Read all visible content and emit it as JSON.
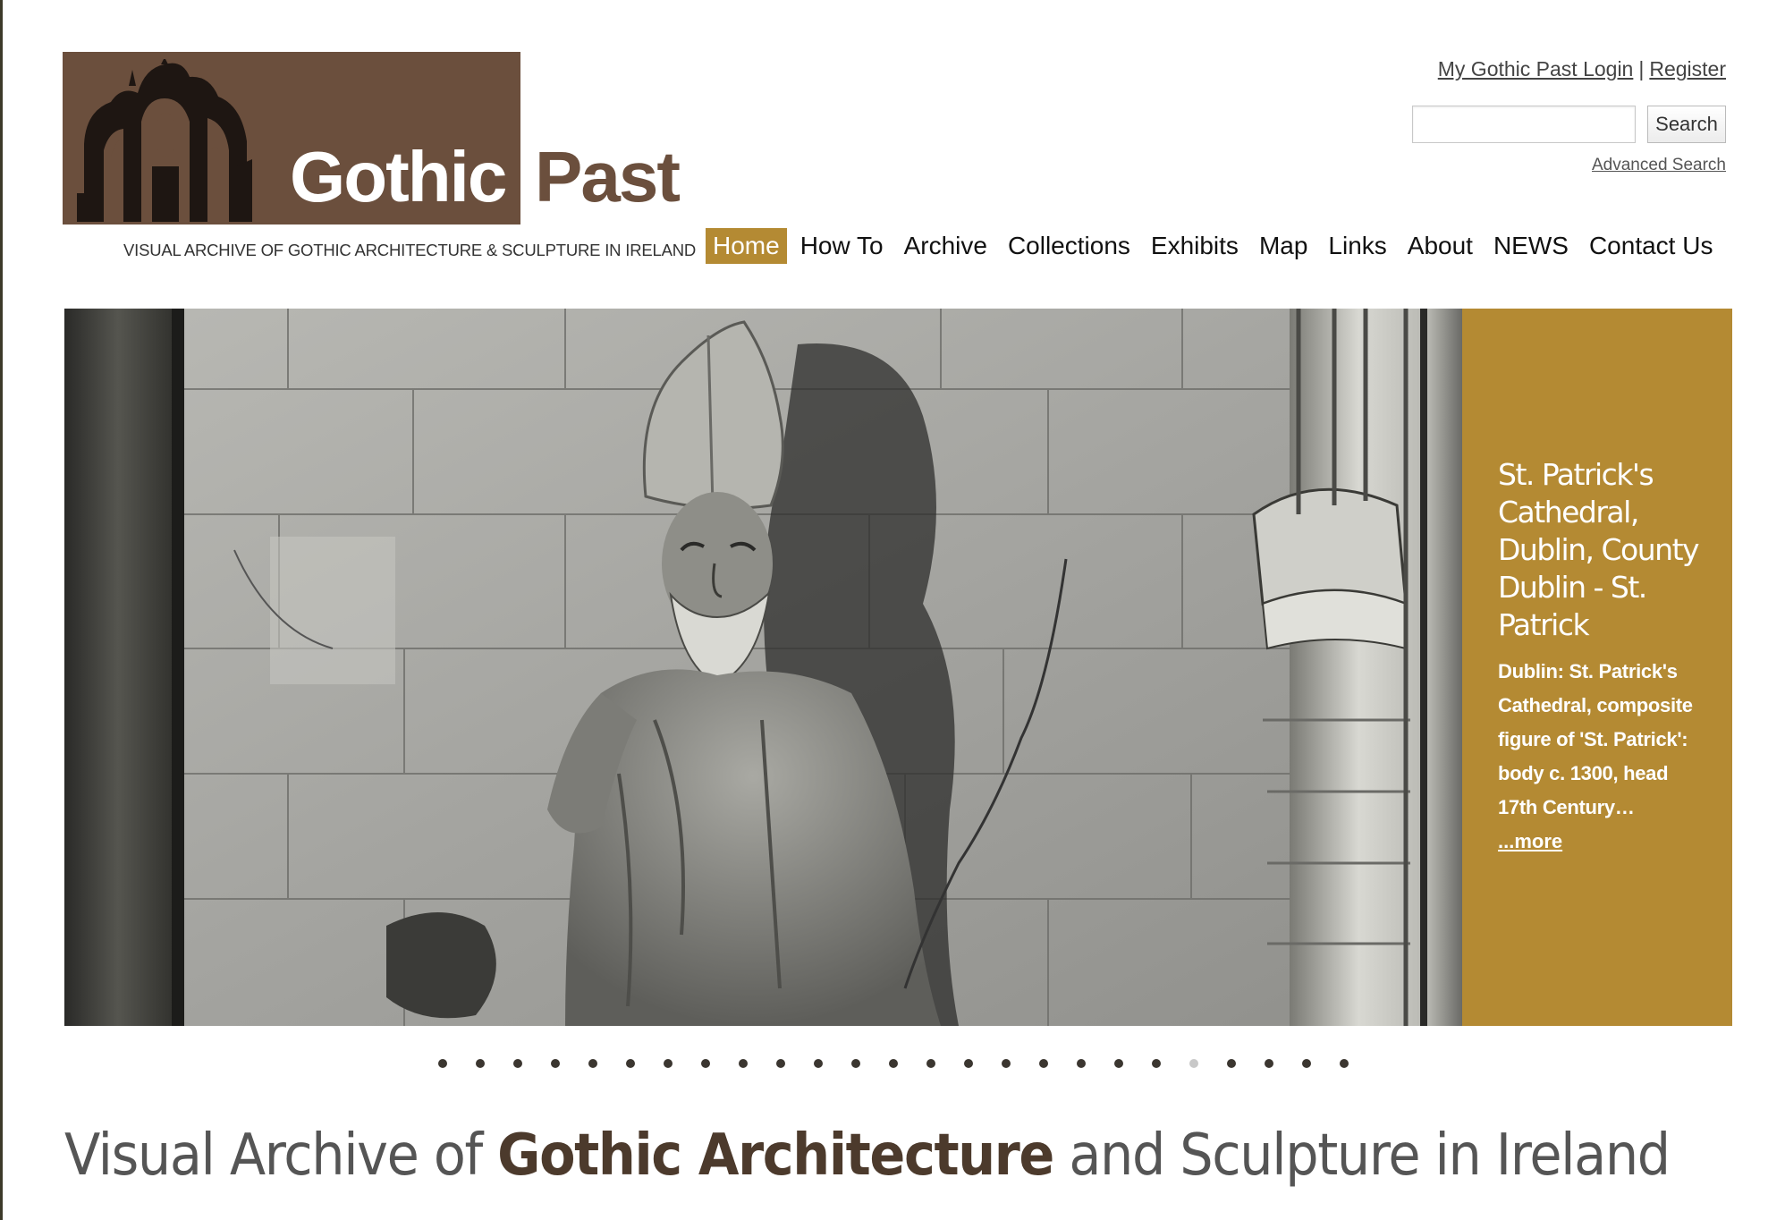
{
  "logo": {
    "word1": "Gothic",
    "word2": "Past",
    "tagline": "VISUAL ARCHIVE OF GOTHIC ARCHITECTURE & SCULPTURE IN IRELAND",
    "brand_color": "#6b4f3d"
  },
  "utility": {
    "login_label": "My Gothic Past Login",
    "separator": "|",
    "register_label": "Register",
    "search_value": "",
    "search_button": "Search",
    "advanced_search": "Advanced Search"
  },
  "nav": {
    "items": [
      {
        "label": "Home",
        "active": true
      },
      {
        "label": "How To",
        "active": false
      },
      {
        "label": "Archive",
        "active": false
      },
      {
        "label": "Collections",
        "active": false
      },
      {
        "label": "Exhibits",
        "active": false
      },
      {
        "label": "Map",
        "active": false
      },
      {
        "label": "Links",
        "active": false
      },
      {
        "label": "About",
        "active": false
      },
      {
        "label": "NEWS",
        "active": false
      },
      {
        "label": "Contact Us",
        "active": false
      }
    ],
    "accent_color": "#b48a33"
  },
  "hero": {
    "image": "black-and-white photograph of the St. Patrick figure in a cathedral wall niche",
    "caption_title": "St. Patrick's Cathedral, Dublin, County Dublin - St. Patrick",
    "caption_text": "Dublin: St. Patrick's Cathedral, composite figure of 'St. Patrick': body c. 1300, head 17th Century…",
    "more_label": "...more",
    "caption_bg": "#b48a33"
  },
  "slider": {
    "total": 25,
    "active_index": 20
  },
  "headline": {
    "part1": "Visual Archive of ",
    "bold": "Gothic Architecture",
    "part2": " and Sculpture in Ireland"
  }
}
